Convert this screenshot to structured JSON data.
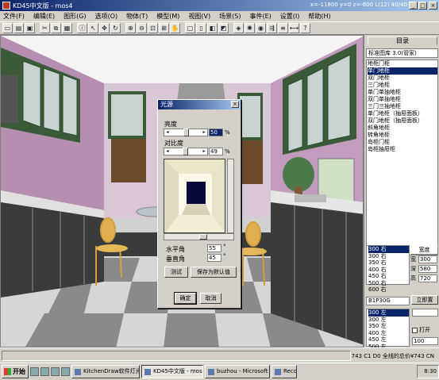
{
  "window": {
    "title": "KD45中文版 - mos4",
    "right_info": "x=-11800 y=0  z=-600  L(12)  40/40"
  },
  "menu": [
    "文件(F)",
    "编辑(E)",
    "图形(G)",
    "选项(O)",
    "物体(T)",
    "模型(M)",
    "视图(V)",
    "场景(S)",
    "事件(E)",
    "设置(I)",
    "帮助(H)"
  ],
  "toolbar_icons": [
    "new-icon",
    "open-icon",
    "save-icon",
    "cut-icon",
    "copy-icon",
    "paste-icon",
    "info-icon",
    "select-icon",
    "move-icon",
    "rotate-icon",
    "zoom-in-icon",
    "zoom-out-icon",
    "zoom-window-icon",
    "zoom-all-icon",
    "pan-icon",
    "view-plan-icon",
    "view-front-icon",
    "view-side-icon",
    "view-3d-icon",
    "render-icon",
    "light-icon",
    "camera-icon",
    "walk-icon",
    "layer-icon",
    "measure-icon",
    "help-icon"
  ],
  "right_panel": {
    "tab": "目录",
    "library": "标准图库 3.0(管家)",
    "items": [
      "地柜门柜",
      "单门地柜",
      "双门地柜",
      "三门地柜",
      "单门单抽地柜",
      "双门单抽地柜",
      "三门三抽地柜",
      "单门地柜（抽屉面板）",
      "双门地柜（抽屉面板）",
      "斜角地柜",
      "转角地柜",
      "岛柜门柜",
      "岛柜抽屉柜"
    ],
    "selected_index": 1,
    "sizes": [
      "300 右",
      "300 右",
      "350 右",
      "400 右",
      "450 右",
      "500 右",
      "600 右"
    ],
    "size_selected": 0,
    "dim_header": "宽度",
    "dims": [
      {
        "label": "宽",
        "value": "300"
      },
      {
        "label": "深",
        "value": "580"
      },
      {
        "label": "高",
        "value": "720"
      }
    ],
    "code": "B1P30G",
    "place_btn": "立即置",
    "sizes2": [
      "300 左",
      "300 左",
      "350 左",
      "400 左",
      "450 左",
      "500 左"
    ],
    "size2_selected": 0,
    "open_label": "打开",
    "small_value": "100"
  },
  "dialog": {
    "title": "光源",
    "brightness_label": "亮度",
    "brightness_value": "50",
    "contrast_label": "对比度",
    "contrast_value": "49",
    "h_angle_label": "水平角",
    "h_angle_value": "55",
    "v_angle_label": "垂直角",
    "v_angle_value": "45",
    "test_btn": "测试",
    "save_default_btn": "保存为默认值",
    "ok_btn": "确定",
    "cancel_btn": "取消",
    "percent": "%",
    "degree": "°",
    "brightness_level": 0.5,
    "contrast_level": 0.49
  },
  "statusbar": {
    "text": "743 C1 D0 全线的总价¥743 CN"
  },
  "taskbar": {
    "start": "开始",
    "tasks": [
      {
        "label": "KitchenDraw软件灯光温...",
        "active": false
      },
      {
        "label": "KD45中文版 - mos4",
        "active": true
      },
      {
        "label": "buzhou - Microsoft Word",
        "active": false
      },
      {
        "label": "Record",
        "active": false
      }
    ],
    "clock": "8:30"
  }
}
